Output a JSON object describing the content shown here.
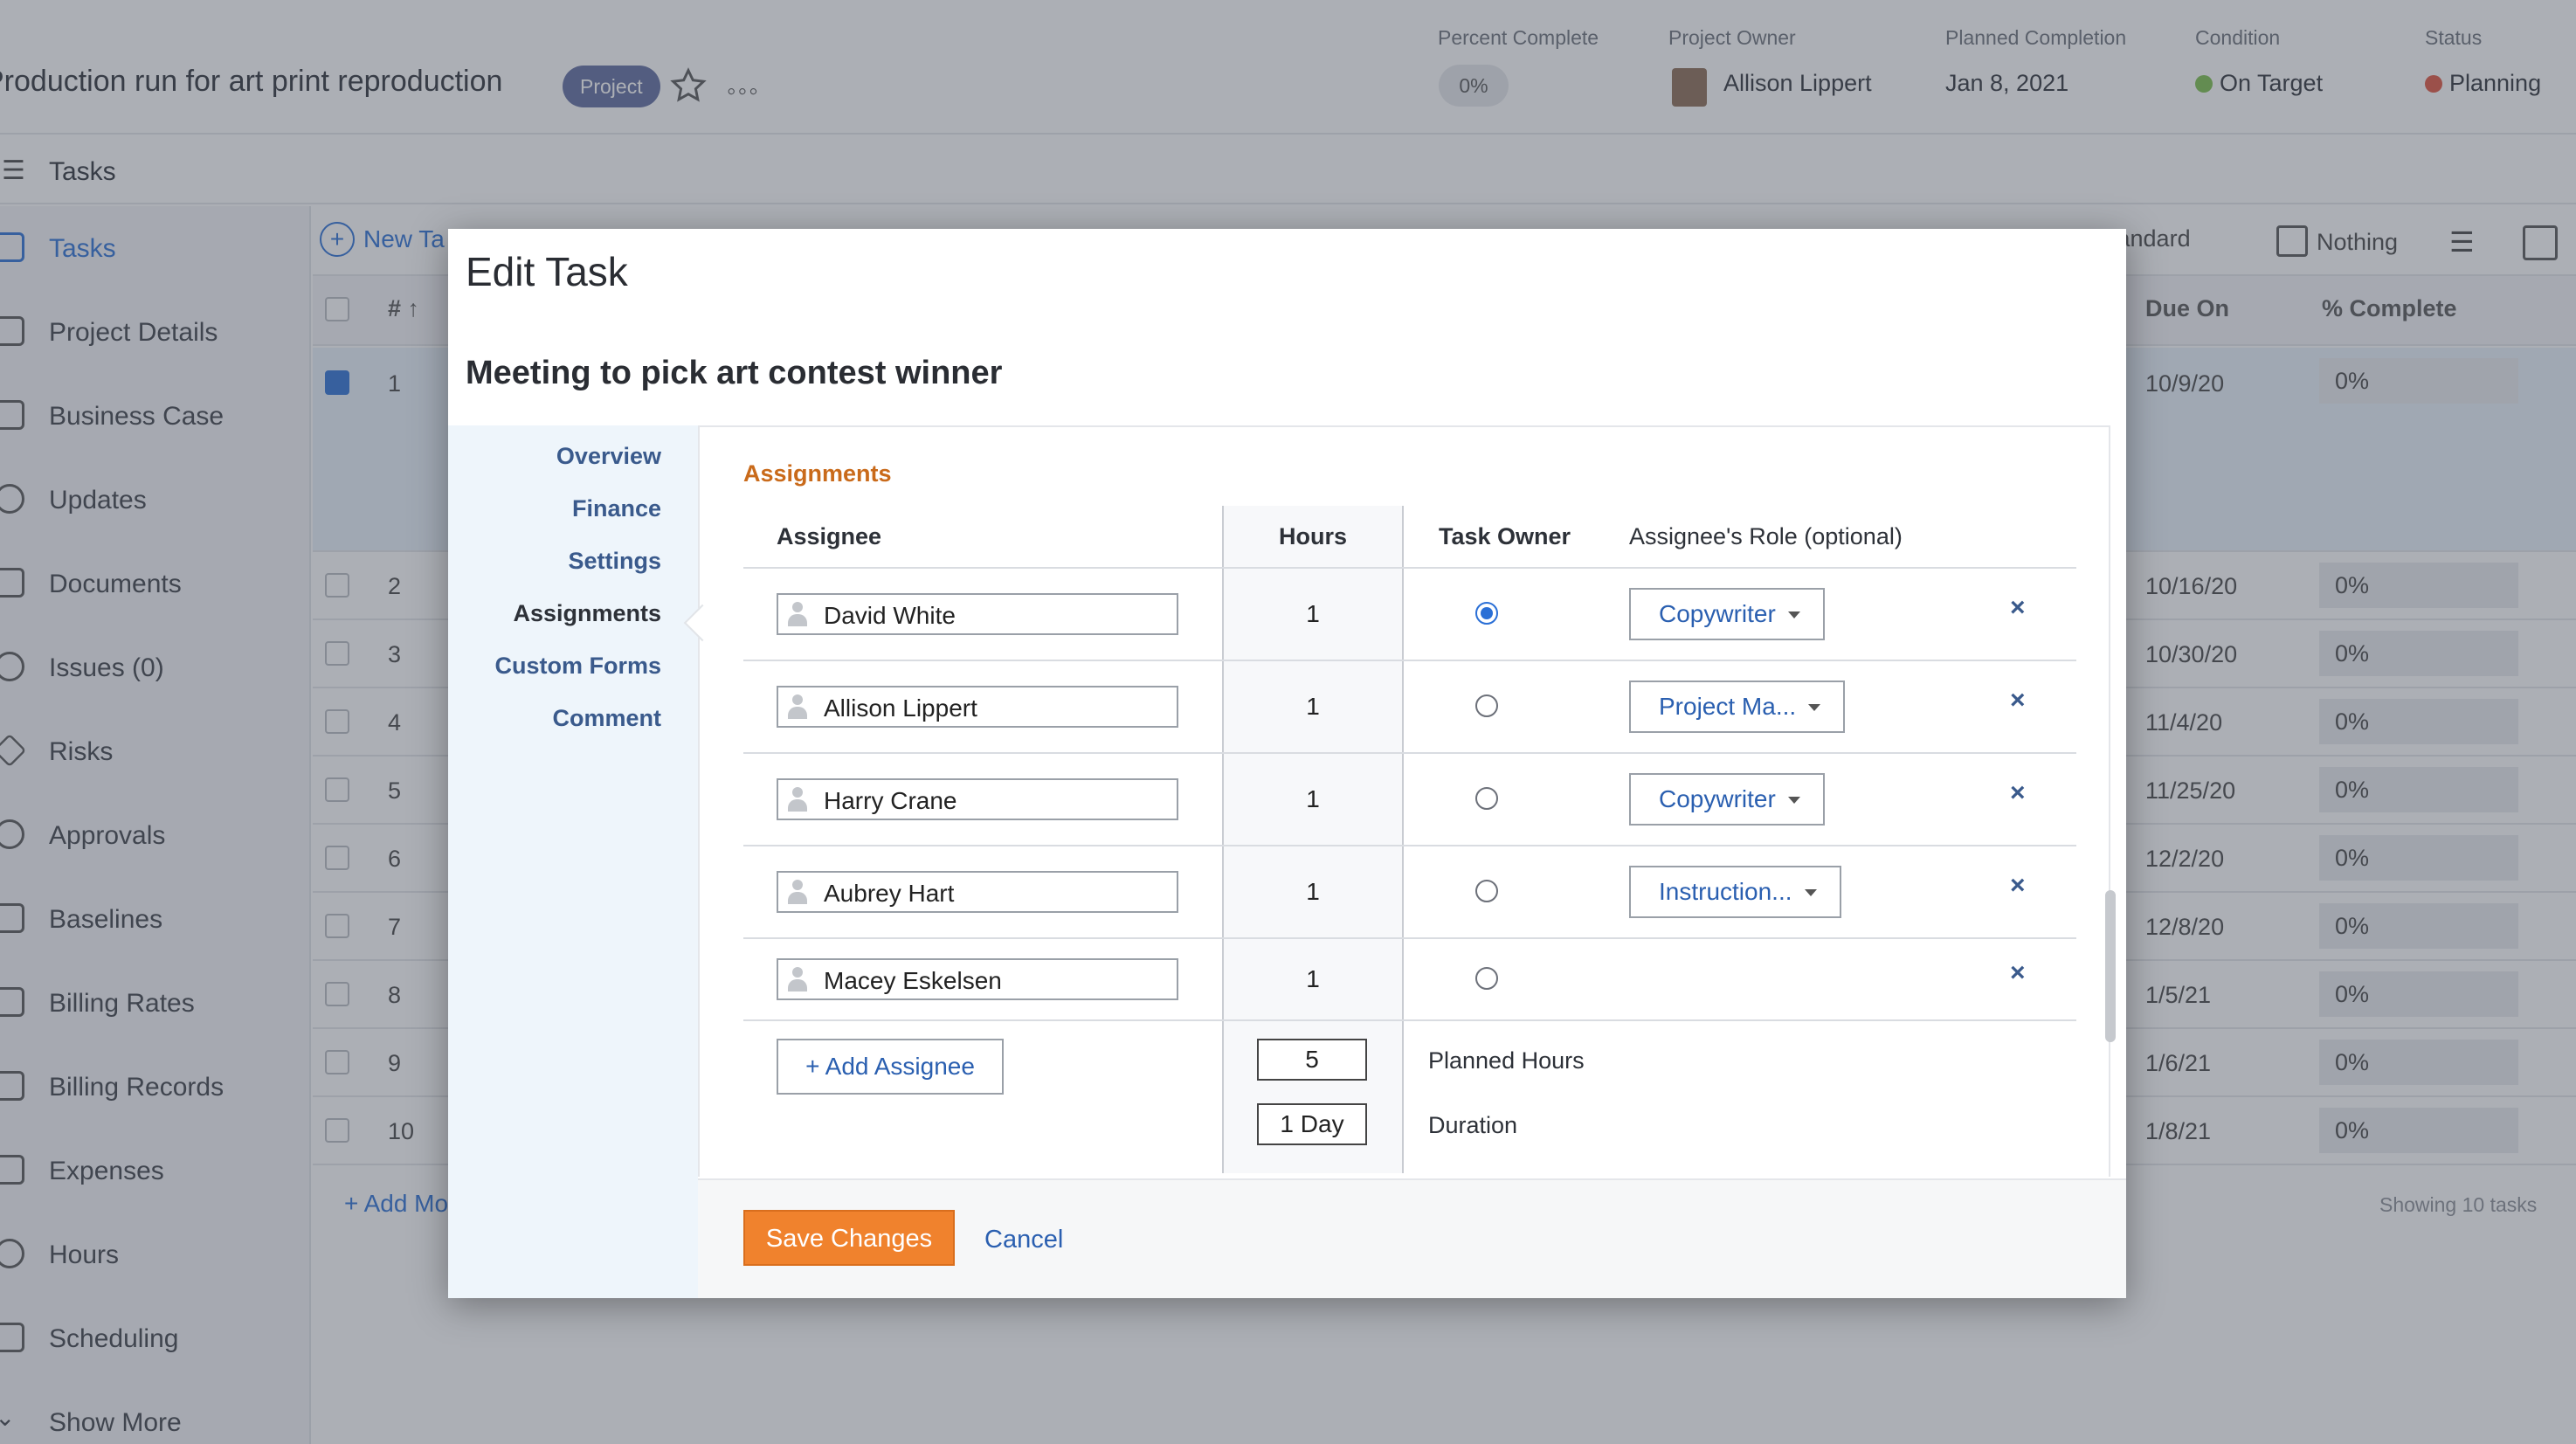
{
  "project": {
    "title": "Production run for art print reproduction",
    "badge": "Project",
    "percent_complete_label": "Percent Complete",
    "percent_complete_value": "0%",
    "owner_label": "Project Owner",
    "owner_value": "Allison Lippert",
    "planned_completion_label": "Planned Completion",
    "planned_completion_value": "Jan 8, 2021",
    "condition_label": "Condition",
    "condition_value": "On Target",
    "condition_color": "#7bbf4a",
    "status_label": "Status",
    "status_value": "Planning",
    "status_color": "#e0533c"
  },
  "subbar": {
    "title": "Tasks"
  },
  "sidebar": {
    "items": [
      {
        "label": "Tasks",
        "active": true
      },
      {
        "label": "Project Details"
      },
      {
        "label": "Business Case"
      },
      {
        "label": "Updates"
      },
      {
        "label": "Documents"
      },
      {
        "label": "Issues (0)"
      },
      {
        "label": "Risks"
      },
      {
        "label": "Approvals"
      },
      {
        "label": "Baselines"
      },
      {
        "label": "Billing Rates"
      },
      {
        "label": "Billing Records"
      },
      {
        "label": "Expenses"
      },
      {
        "label": "Hours"
      },
      {
        "label": "Scheduling"
      },
      {
        "label": "Show More"
      }
    ]
  },
  "toolbar": {
    "new_task": "New Ta",
    "view": "Standard",
    "grouping": "Nothing"
  },
  "table": {
    "columns": {
      "num": "# ↑",
      "due": "Due On",
      "pct": "% Complete"
    },
    "rows": [
      {
        "num": "1",
        "due": "10/9/20",
        "pct": "0%"
      },
      {
        "num": "2",
        "due": "10/16/20",
        "pct": "0%"
      },
      {
        "num": "3",
        "due": "10/30/20",
        "pct": "0%"
      },
      {
        "num": "4",
        "due": "11/4/20",
        "pct": "0%"
      },
      {
        "num": "5",
        "due": "11/25/20",
        "pct": "0%"
      },
      {
        "num": "6",
        "due": "12/2/20",
        "pct": "0%"
      },
      {
        "num": "7",
        "due": "12/8/20",
        "pct": "0%"
      },
      {
        "num": "8",
        "due": "1/5/21",
        "pct": "0%"
      },
      {
        "num": "9",
        "due": "1/6/21",
        "pct": "0%"
      },
      {
        "num": "10",
        "due": "1/8/21",
        "pct": "0%"
      }
    ],
    "add_more": "+ Add Mo",
    "showing": "Showing 10 tasks"
  },
  "modal": {
    "title": "Edit Task",
    "task_name": "Meeting to pick art contest winner",
    "nav": [
      "Overview",
      "Finance",
      "Settings",
      "Assignments",
      "Custom Forms",
      "Comment"
    ],
    "section_title": "Assignments",
    "headers": {
      "assignee": "Assignee",
      "hours": "Hours",
      "task_owner": "Task Owner",
      "role": "Assignee's Role (optional)"
    },
    "assignments": [
      {
        "name": "David White",
        "hours": "1",
        "owner": true,
        "role": "Copywriter"
      },
      {
        "name": "Allison Lippert",
        "hours": "1",
        "owner": false,
        "role": "Project Ma..."
      },
      {
        "name": "Harry Crane",
        "hours": "1",
        "owner": false,
        "role": "Copywriter"
      },
      {
        "name": "Aubrey Hart",
        "hours": "1",
        "owner": false,
        "role": "Instruction..."
      },
      {
        "name": "Macey Eskelsen",
        "hours": "1",
        "owner": false,
        "role": ""
      }
    ],
    "remove_glyph": "×",
    "add_assignee": "+ Add Assignee",
    "planned_hours_value": "5",
    "planned_hours_label": "Planned Hours",
    "duration_value": "1 Day",
    "duration_label": "Duration",
    "save": "Save Changes",
    "cancel": "Cancel"
  }
}
